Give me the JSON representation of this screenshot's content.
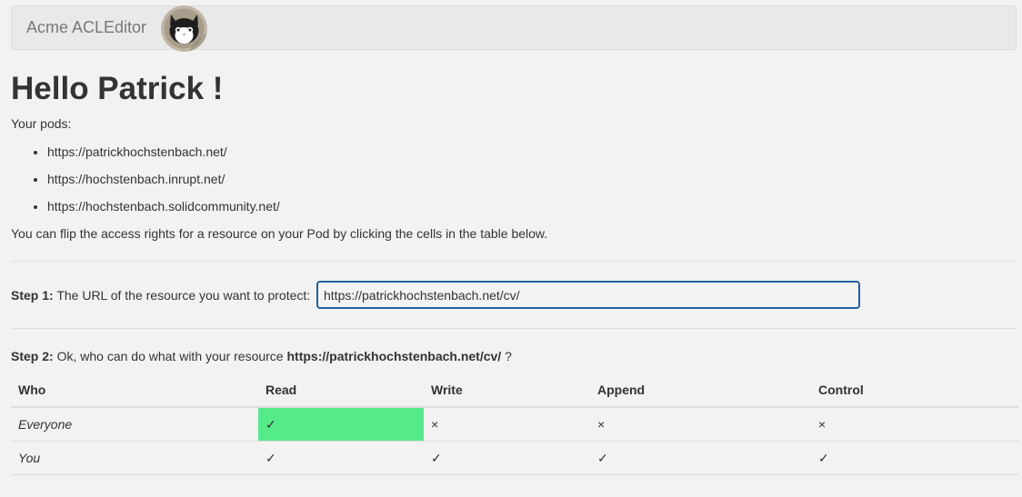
{
  "navbar": {
    "brand": "Acme ACLEditor"
  },
  "greeting": "Hello Patrick !",
  "pods": {
    "label": "Your pods:",
    "items": [
      "https://patrickhochstenbach.net/",
      "https://hochstenbach.inrupt.net/",
      "https://hochstenbach.solidcommunity.net/"
    ]
  },
  "hint": "You can flip the access rights for a resource on your Pod by clicking the cells in the table below.",
  "step1": {
    "label_bold": "Step 1:",
    "label_text": " The URL of the resource you want to protect:",
    "input_value": "https://patrickhochstenbach.net/cv/"
  },
  "step2": {
    "label_bold": "Step 2:",
    "label_text": " Ok, who can do what with your resource ",
    "resource": "https://patrickhochstenbach.net/cv/",
    "suffix": " ?"
  },
  "table": {
    "headers": [
      "Who",
      "Read",
      "Write",
      "Append",
      "Control"
    ],
    "rows": [
      {
        "who": "Everyone",
        "read": "✓",
        "write": "×",
        "append": "×",
        "control": "×"
      },
      {
        "who": "You",
        "read": "✓",
        "write": "✓",
        "append": "✓",
        "control": "✓"
      }
    ]
  },
  "colors": {
    "accent": "#1f5fa0",
    "granted_highlight": "#55eb8b"
  },
  "icons": {
    "logo": "cat-avatar-icon"
  }
}
